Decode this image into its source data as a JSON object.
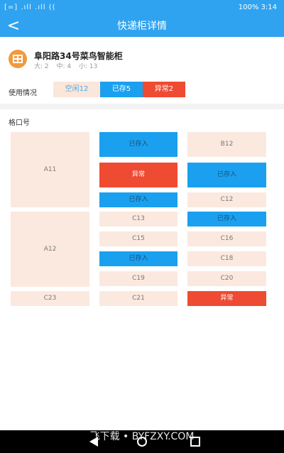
{
  "statusbar": {
    "left": "[=] .ıll .ıll ((",
    "battery": "100%",
    "time": "3:14"
  },
  "header": {
    "title": "快递柜详情",
    "back_glyph": "<"
  },
  "cabinet": {
    "name": "阜阳路34号菜鸟智能柜",
    "sizes": [
      "大: 2",
      "中: 4",
      "小: 13"
    ]
  },
  "usage": {
    "label": "使用情况",
    "tags": {
      "free": "空闲12",
      "stored": "已存5",
      "abnormal": "异常2"
    }
  },
  "section_title": "格口号",
  "slots": [
    {
      "label": "A11",
      "status": "free"
    },
    {
      "label": "已存入",
      "status": "stored"
    },
    {
      "label": "B12",
      "status": "free"
    },
    {
      "label": "异常",
      "status": "abnormal"
    },
    {
      "label": "已存入",
      "status": "stored"
    },
    {
      "label": "已存入",
      "status": "stored"
    },
    {
      "label": "C12",
      "status": "free"
    },
    {
      "label": "A12",
      "status": "free"
    },
    {
      "label": "C13",
      "status": "free"
    },
    {
      "label": "已存入",
      "status": "stored"
    },
    {
      "label": "C15",
      "status": "free"
    },
    {
      "label": "C16",
      "status": "free"
    },
    {
      "label": "已存入",
      "status": "stored"
    },
    {
      "label": "C18",
      "status": "free"
    },
    {
      "label": "C19",
      "status": "free"
    },
    {
      "label": "C20",
      "status": "free"
    },
    {
      "label": "C23",
      "status": "free"
    },
    {
      "label": "C21",
      "status": "free"
    },
    {
      "label": "异常",
      "status": "abnormal"
    }
  ],
  "watermark": "飞下载 • BYFZXY.COM",
  "colors": {
    "primary": "#2fa3f0",
    "stored": "#1aa0ef",
    "abnormal": "#ef4a32",
    "free": "#fbe9df",
    "icon": "#f19a3e"
  }
}
